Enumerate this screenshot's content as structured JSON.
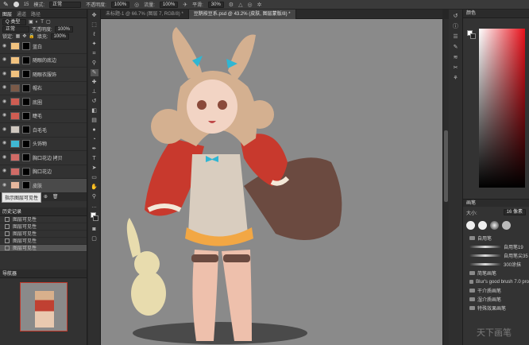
{
  "options_bar": {
    "mode_label": "模式:",
    "mode_value": "正常",
    "opacity_label": "不透明度:",
    "opacity_value": "100%",
    "flow_label": "流量:",
    "flow_value": "100%",
    "smooth_label": "平滑:",
    "smooth_value": "30%",
    "brush_size": "15"
  },
  "doc_tabs": [
    {
      "label": "未标题-1 @ 66.7% (图层 7, RGB/8) *"
    },
    {
      "label": "豆鹅按豆系.psd @ 43.2% (皮肤, 图层蒙版/8) *"
    }
  ],
  "layers_panel": {
    "tabs": [
      "图层",
      "通道",
      "路径"
    ],
    "kind_label": "Q 类型",
    "blend_mode": "正常",
    "opacity_label": "不透明度:",
    "opacity_value": "100%",
    "lock_label": "锁定:",
    "fill_label": "填充:",
    "fill_value": "100%",
    "layers": [
      {
        "name": "蓝白",
        "thumb": "#f1c27f"
      },
      {
        "name": "随眼的底边",
        "thumb": "#f1c27f"
      },
      {
        "name": "随眼衣服饰",
        "thumb": "#f1c27f"
      },
      {
        "name": "帽右",
        "thumb": "#7a5a48"
      },
      {
        "name": "底圈",
        "thumb": "#cf5d52"
      },
      {
        "name": "睫毛",
        "thumb": "#cf5d52"
      },
      {
        "name": "白毛毛",
        "thumb": "#d0c8c0"
      },
      {
        "name": "头饰物",
        "thumb": "#3fb8d4"
      },
      {
        "name": "胸口花边 拷贝",
        "thumb": "#d06b66"
      },
      {
        "name": "胸口花边",
        "thumb": "#d06b66"
      },
      {
        "name": "皮肤",
        "thumb": "#e6b79e"
      }
    ],
    "tooltip": "指示图层可见性"
  },
  "history_panel": {
    "title": "历史记录",
    "items": [
      "图层可见性",
      "图层可见性",
      "图层可见性",
      "图层可见性",
      "图层可见性"
    ]
  },
  "navigator_panel": {
    "title": "导航器"
  },
  "color_panel": {
    "title": "颜色",
    "fg_color": "#ffffff",
    "bg_color": "#222222",
    "hue_color": "#e8101a"
  },
  "brushes_panel": {
    "title": "画笔",
    "size_label": "大小:",
    "size_value": "16 像素",
    "items": [
      "自用笔",
      "自用笔19",
      "自用笔尖35",
      "300涂抹",
      "简笔画笔",
      "Blur's good brush 7.0 pro",
      "干介质画笔",
      "湿介质画笔",
      "特殊效果画笔"
    ]
  },
  "watermark": "天下画笔"
}
